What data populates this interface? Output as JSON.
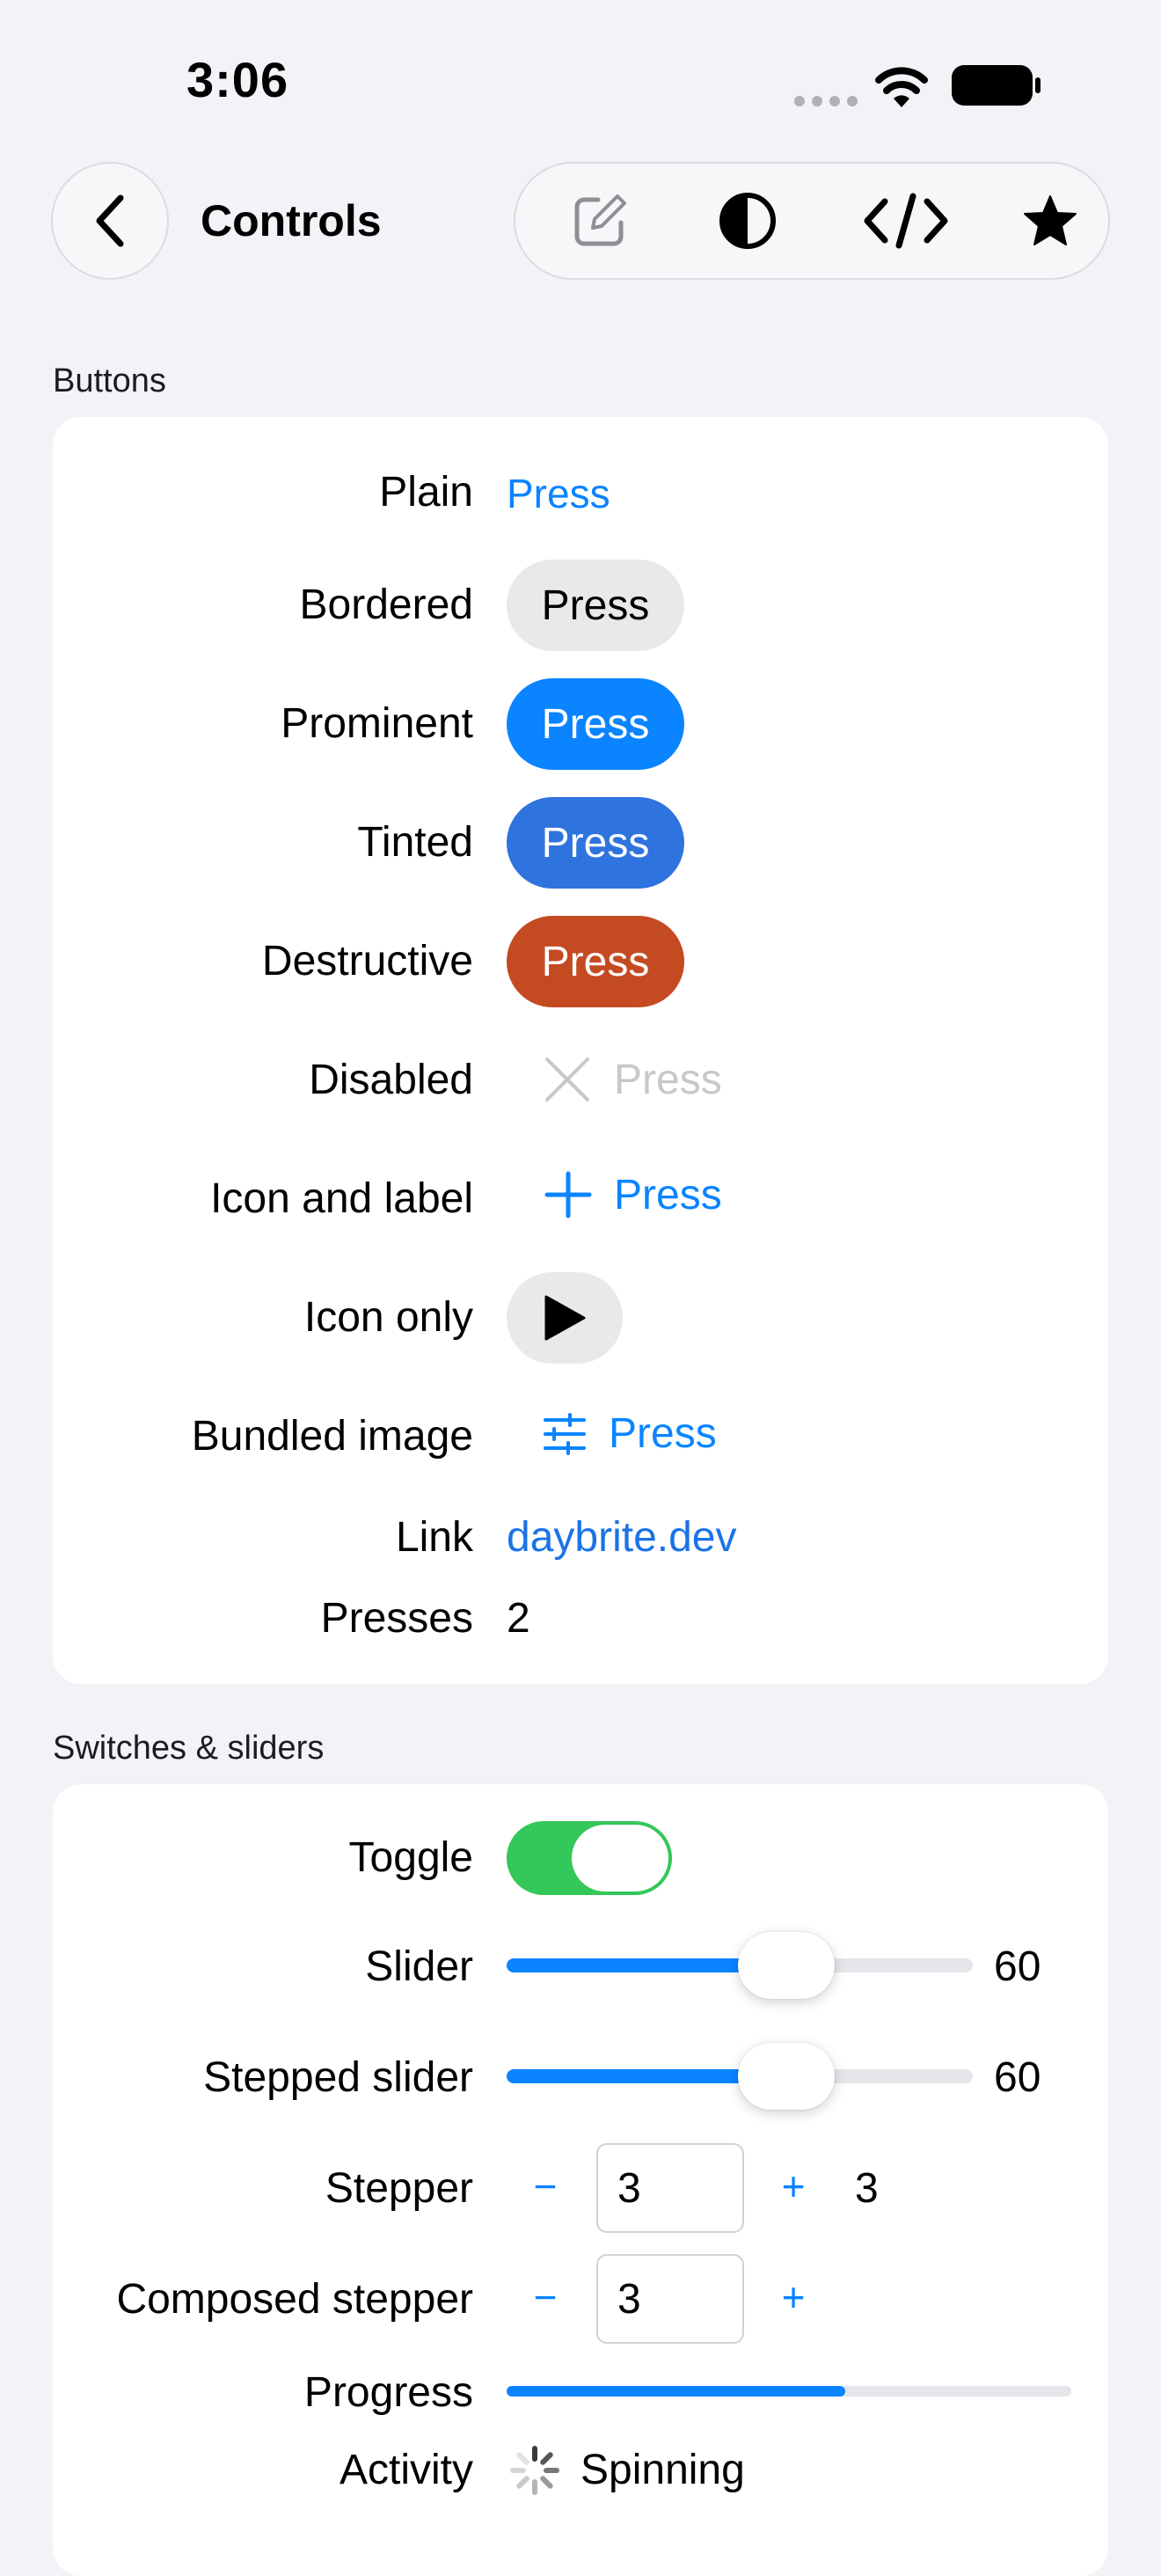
{
  "status_bar": {
    "time": "3:06"
  },
  "nav": {
    "back_icon": "chevron-left-icon",
    "title": "Controls",
    "toolbar_icons": [
      "compose-icon",
      "contrast-icon",
      "code-icon",
      "star-icon"
    ]
  },
  "buttons_section": {
    "header": "Buttons",
    "rows": {
      "plain": {
        "label": "Plain",
        "button": "Press"
      },
      "bordered": {
        "label": "Bordered",
        "button": "Press"
      },
      "prominent": {
        "label": "Prominent",
        "button": "Press"
      },
      "tinted": {
        "label": "Tinted",
        "button": "Press"
      },
      "destructive": {
        "label": "Destructive",
        "button": "Press"
      },
      "disabled": {
        "label": "Disabled",
        "button": "Press",
        "icon": "xmark-icon"
      },
      "icon_and_label": {
        "label": "Icon and label",
        "button": "Press",
        "icon": "plus-icon"
      },
      "icon_only": {
        "label": "Icon only",
        "icon": "play-icon"
      },
      "bundled_image": {
        "label": "Bundled image",
        "button": "Press",
        "icon": "sliders-icon"
      },
      "link": {
        "label": "Link",
        "text": "daybrite.dev"
      },
      "presses": {
        "label": "Presses",
        "value": "2"
      }
    }
  },
  "switches_section": {
    "header": "Switches & sliders",
    "toggle": {
      "label": "Toggle",
      "on": true
    },
    "slider": {
      "label": "Slider",
      "value": "60",
      "fraction": 0.6
    },
    "stepped_slider": {
      "label": "Stepped slider",
      "value": "60",
      "fraction": 0.6
    },
    "stepper": {
      "label": "Stepper",
      "minus": "−",
      "plus": "+",
      "field": "3",
      "value": "3"
    },
    "composed_stepper": {
      "label": "Composed stepper",
      "minus": "−",
      "plus": "+",
      "field": "3"
    },
    "progress": {
      "label": "Progress",
      "fraction": 0.6
    },
    "activity": {
      "label": "Activity",
      "text": "Spinning",
      "icon": "spinner-icon"
    }
  },
  "colors": {
    "accent": "#0a84ff",
    "tinted": "#2f73de",
    "destructive": "#c44a22",
    "toggle_on": "#34c759",
    "background": "#f2f2f7"
  }
}
